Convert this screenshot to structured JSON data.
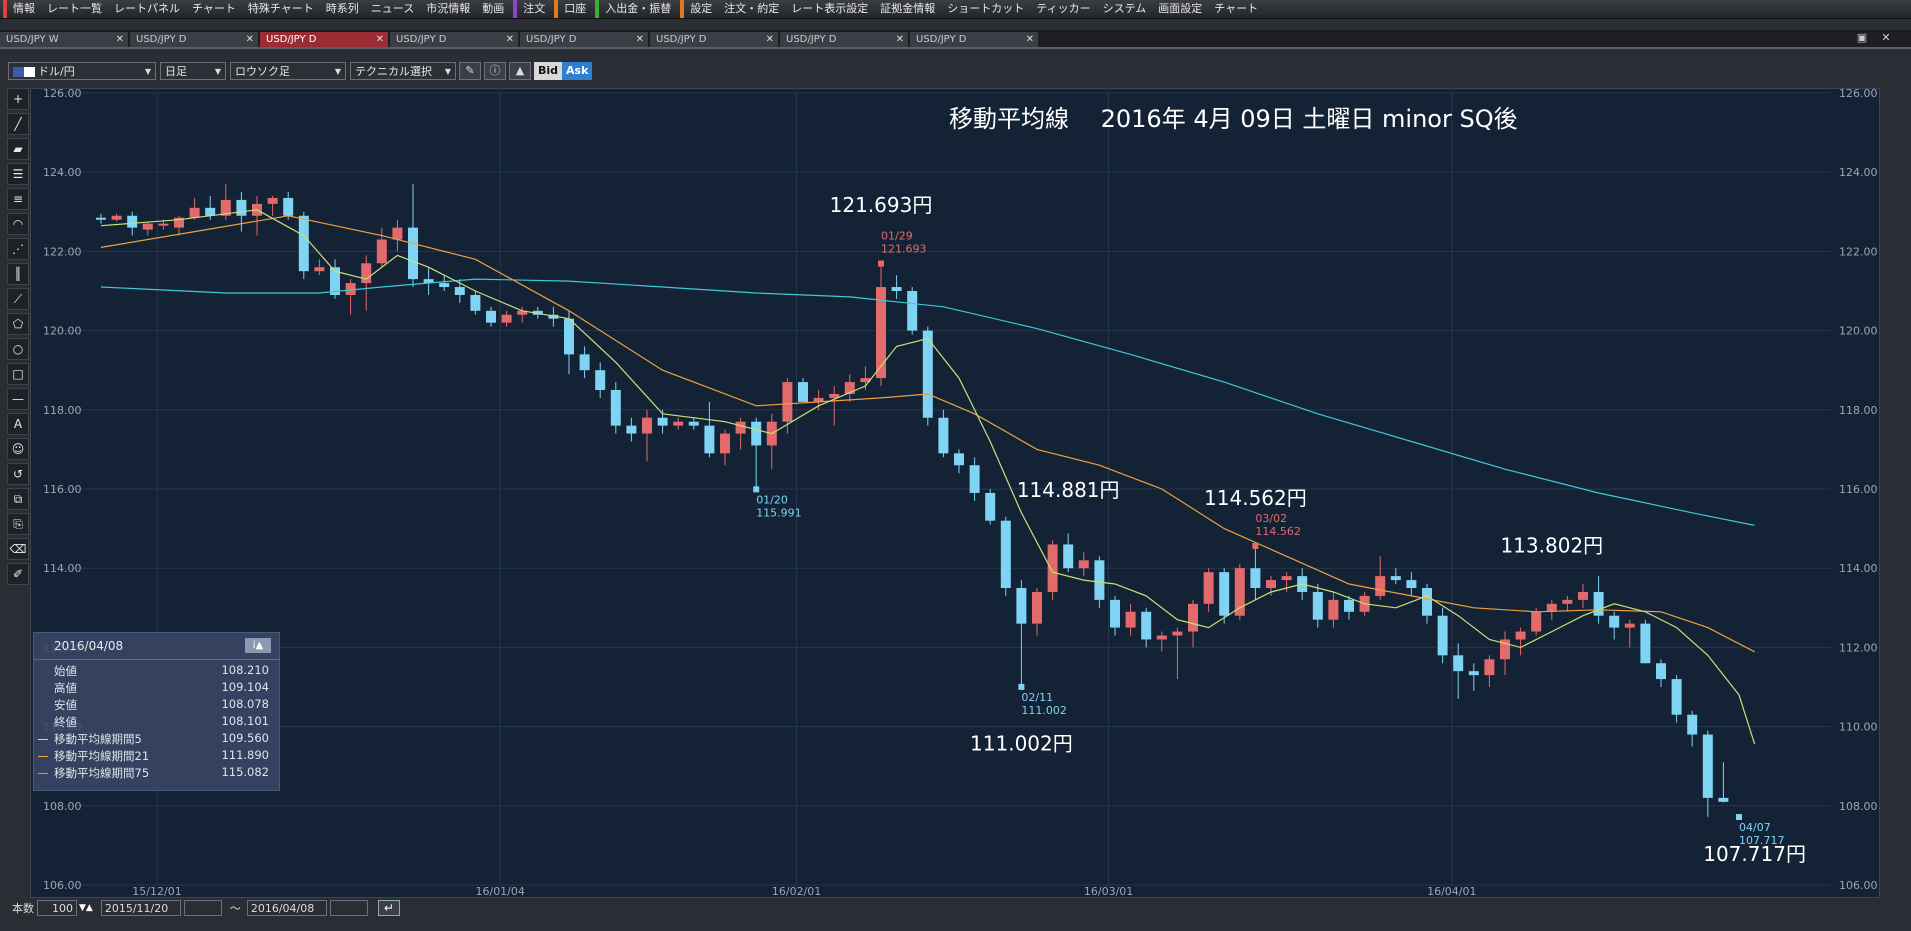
{
  "menu": [
    {
      "label": "情報",
      "accent": "#e04040"
    },
    {
      "label": "レート一覧"
    },
    {
      "label": "レートパネル"
    },
    {
      "label": "チャート"
    },
    {
      "label": "特殊チャート"
    },
    {
      "label": "時系列"
    },
    {
      "label": "ニュース"
    },
    {
      "label": "市況情報"
    },
    {
      "label": "動画"
    },
    {
      "label": "注文",
      "accent": "#8e44c8"
    },
    {
      "label": "口座",
      "accent": "#e07a20"
    },
    {
      "label": "入出金・振替",
      "accent": "#3cae3c"
    },
    {
      "label": "設定",
      "accent": "#e07a20"
    },
    {
      "label": "注文・約定"
    },
    {
      "label": "レート表示設定"
    },
    {
      "label": "証拠金情報"
    },
    {
      "label": "ショートカット"
    },
    {
      "label": "ティッカー"
    },
    {
      "label": "システム"
    },
    {
      "label": "画面設定"
    },
    {
      "label": "チャート"
    }
  ],
  "tabs": [
    {
      "label": "USD/JPY W",
      "active": false
    },
    {
      "label": "USD/JPY D",
      "active": false
    },
    {
      "label": "USD/JPY D",
      "active": true
    },
    {
      "label": "USD/JPY D",
      "active": false
    },
    {
      "label": "USD/JPY D",
      "active": false
    },
    {
      "label": "USD/JPY D",
      "active": false
    },
    {
      "label": "USD/JPY D",
      "active": false
    },
    {
      "label": "USD/JPY D",
      "active": false
    }
  ],
  "toolbar": {
    "pair": "ドル/円",
    "period": "日足",
    "style": "ロウソク足",
    "technical": "テクニカル選択",
    "bid": "Bid",
    "ask": "Ask"
  },
  "chart_data": {
    "type": "candlestick",
    "title": "移動平均線　 2016年 4月 09日 土曜日  minor SQ後",
    "ylim": [
      106,
      126
    ],
    "y_ticks": [
      "126.00",
      "124.00",
      "122.00",
      "120.00",
      "118.00",
      "116.00",
      "114.00",
      "112.00",
      "110.00",
      "108.00",
      "106.00"
    ],
    "x_ticks": [
      {
        "label": "15/12/01",
        "index": 0
      },
      {
        "label": "16/01/04",
        "index": 22
      },
      {
        "label": "16/02/01",
        "index": 41
      },
      {
        "label": "16/03/01",
        "index": 61
      },
      {
        "label": "16/04/01",
        "index": 83
      }
    ],
    "colors": {
      "up": "#e26a6a",
      "down": "#7fd3f3",
      "ma5": "#c9e07a",
      "ma21": "#f0a040",
      "ma75": "#3ec8d6"
    },
    "candles": [
      [
        122.85,
        122.95,
        122.7,
        122.8
      ],
      [
        122.8,
        122.95,
        122.75,
        122.9
      ],
      [
        122.9,
        123.0,
        122.4,
        122.6
      ],
      [
        122.55,
        122.75,
        122.4,
        122.7
      ],
      [
        122.65,
        122.8,
        122.55,
        122.7
      ],
      [
        122.6,
        122.9,
        122.4,
        122.85
      ],
      [
        122.85,
        123.35,
        122.8,
        123.1
      ],
      [
        123.1,
        123.4,
        122.8,
        122.9
      ],
      [
        122.9,
        123.7,
        122.8,
        123.3
      ],
      [
        123.3,
        123.5,
        122.5,
        122.9
      ],
      [
        122.9,
        123.4,
        122.4,
        123.2
      ],
      [
        123.2,
        123.4,
        122.9,
        123.35
      ],
      [
        123.35,
        123.5,
        122.8,
        122.9
      ],
      [
        122.9,
        123.0,
        121.3,
        121.5
      ],
      [
        121.5,
        121.8,
        121.4,
        121.6
      ],
      [
        121.6,
        121.8,
        120.8,
        120.9
      ],
      [
        120.9,
        121.3,
        120.4,
        121.2
      ],
      [
        121.2,
        121.9,
        120.5,
        121.7
      ],
      [
        121.7,
        122.6,
        121.6,
        122.3
      ],
      [
        122.3,
        122.8,
        122.0,
        122.6
      ],
      [
        122.6,
        123.7,
        121.1,
        121.3
      ],
      [
        121.3,
        121.6,
        120.9,
        121.2
      ],
      [
        121.2,
        121.4,
        121.0,
        121.1
      ],
      [
        121.1,
        121.3,
        120.7,
        120.9
      ],
      [
        120.9,
        121.0,
        120.4,
        120.5
      ],
      [
        120.5,
        120.6,
        120.1,
        120.2
      ],
      [
        120.2,
        120.5,
        120.1,
        120.4
      ],
      [
        120.4,
        120.6,
        120.2,
        120.5
      ],
      [
        120.5,
        120.6,
        120.3,
        120.4
      ],
      [
        120.4,
        120.6,
        120.1,
        120.3
      ],
      [
        120.3,
        120.5,
        118.9,
        119.4
      ],
      [
        119.4,
        119.6,
        118.8,
        119.0
      ],
      [
        119.0,
        119.2,
        118.3,
        118.5
      ],
      [
        118.5,
        118.7,
        117.4,
        117.6
      ],
      [
        117.6,
        117.8,
        117.2,
        117.4
      ],
      [
        117.4,
        118.0,
        116.7,
        117.8
      ],
      [
        117.8,
        118.0,
        117.4,
        117.6
      ],
      [
        117.6,
        117.8,
        117.5,
        117.7
      ],
      [
        117.7,
        117.8,
        117.5,
        117.6
      ],
      [
        117.6,
        118.2,
        116.8,
        116.9
      ],
      [
        116.9,
        117.5,
        116.6,
        117.4
      ],
      [
        117.4,
        117.8,
        117.0,
        117.7
      ],
      [
        117.7,
        117.8,
        115.99,
        117.1
      ],
      [
        117.1,
        117.9,
        116.5,
        117.7
      ],
      [
        117.7,
        118.8,
        117.4,
        118.7
      ],
      [
        118.7,
        118.8,
        118.2,
        118.2
      ],
      [
        118.2,
        118.5,
        118.0,
        118.3
      ],
      [
        118.3,
        118.6,
        117.6,
        118.4
      ],
      [
        118.4,
        118.9,
        118.2,
        118.7
      ],
      [
        118.7,
        119.1,
        118.5,
        118.8
      ],
      [
        118.8,
        121.69,
        118.6,
        121.1
      ],
      [
        121.1,
        121.4,
        120.8,
        121.0
      ],
      [
        121.0,
        121.1,
        119.9,
        120.0
      ],
      [
        120.0,
        120.1,
        117.6,
        117.8
      ],
      [
        117.8,
        118.0,
        116.8,
        116.9
      ],
      [
        116.9,
        117.0,
        116.4,
        116.6
      ],
      [
        116.6,
        116.8,
        115.7,
        115.9
      ],
      [
        115.9,
        116.0,
        115.1,
        115.2
      ],
      [
        115.2,
        115.3,
        113.3,
        113.5
      ],
      [
        113.5,
        113.7,
        111.0,
        112.6
      ],
      [
        112.6,
        113.5,
        112.3,
        113.4
      ],
      [
        113.4,
        114.7,
        113.2,
        114.6
      ],
      [
        114.6,
        114.88,
        113.9,
        114.0
      ],
      [
        114.0,
        114.4,
        113.8,
        114.2
      ],
      [
        114.2,
        114.3,
        113.0,
        113.2
      ],
      [
        113.2,
        113.3,
        112.3,
        112.5
      ],
      [
        112.5,
        113.1,
        112.3,
        112.9
      ],
      [
        112.9,
        113.0,
        112.0,
        112.2
      ],
      [
        112.2,
        112.4,
        111.9,
        112.3
      ],
      [
        112.3,
        112.5,
        111.2,
        112.4
      ],
      [
        112.4,
        113.2,
        112.0,
        113.1
      ],
      [
        113.1,
        114.0,
        112.9,
        113.9
      ],
      [
        113.9,
        114.0,
        112.6,
        112.8
      ],
      [
        112.8,
        114.1,
        112.7,
        114.0
      ],
      [
        114.0,
        114.56,
        113.2,
        113.5
      ],
      [
        113.5,
        113.8,
        113.3,
        113.7
      ],
      [
        113.7,
        113.9,
        113.4,
        113.8
      ],
      [
        113.8,
        114.0,
        113.2,
        113.4
      ],
      [
        113.4,
        113.6,
        112.5,
        112.7
      ],
      [
        112.7,
        113.4,
        112.5,
        113.2
      ],
      [
        113.2,
        113.3,
        112.7,
        112.9
      ],
      [
        112.9,
        113.4,
        112.8,
        113.3
      ],
      [
        113.3,
        114.3,
        113.2,
        113.8
      ],
      [
        113.8,
        114.0,
        113.6,
        113.7
      ],
      [
        113.7,
        113.9,
        113.3,
        113.5
      ],
      [
        113.5,
        113.6,
        112.6,
        112.8
      ],
      [
        112.8,
        113.0,
        111.6,
        111.8
      ],
      [
        111.8,
        112.1,
        110.7,
        111.4
      ],
      [
        111.4,
        111.6,
        110.9,
        111.3
      ],
      [
        111.3,
        111.8,
        111.0,
        111.7
      ],
      [
        111.7,
        112.4,
        111.3,
        112.2
      ],
      [
        112.2,
        112.5,
        111.8,
        112.4
      ],
      [
        112.4,
        113.0,
        112.3,
        112.9
      ],
      [
        112.9,
        113.2,
        112.7,
        113.1
      ],
      [
        113.1,
        113.3,
        112.9,
        113.2
      ],
      [
        113.2,
        113.6,
        113.0,
        113.4
      ],
      [
        113.4,
        113.8,
        112.6,
        112.8
      ],
      [
        112.8,
        112.9,
        112.2,
        112.5
      ],
      [
        112.5,
        112.7,
        112.0,
        112.6
      ],
      [
        112.6,
        112.7,
        111.6,
        111.6
      ],
      [
        111.6,
        111.7,
        111.0,
        111.2
      ],
      [
        111.2,
        111.3,
        110.1,
        110.3
      ],
      [
        110.3,
        110.4,
        109.5,
        109.8
      ],
      [
        109.8,
        109.9,
        107.72,
        108.2
      ],
      [
        108.2,
        109.1,
        108.08,
        108.1
      ]
    ],
    "ma5": [
      [
        0,
        122.65
      ],
      [
        5,
        122.8
      ],
      [
        10,
        123.05
      ],
      [
        13,
        122.4
      ],
      [
        15,
        121.5
      ],
      [
        17,
        121.3
      ],
      [
        19,
        121.9
      ],
      [
        21,
        121.6
      ],
      [
        24,
        121.0
      ],
      [
        27,
        120.5
      ],
      [
        30,
        120.3
      ],
      [
        33,
        119.2
      ],
      [
        36,
        117.9
      ],
      [
        40,
        117.7
      ],
      [
        43,
        117.4
      ],
      [
        46,
        118.1
      ],
      [
        49,
        118.6
      ],
      [
        51,
        119.6
      ],
      [
        53,
        119.8
      ],
      [
        55,
        118.8
      ],
      [
        57,
        117.2
      ],
      [
        59,
        115.4
      ],
      [
        61,
        113.9
      ],
      [
        63,
        113.7
      ],
      [
        65,
        113.6
      ],
      [
        67,
        113.3
      ],
      [
        69,
        112.7
      ],
      [
        71,
        112.5
      ],
      [
        73,
        113.0
      ],
      [
        75,
        113.4
      ],
      [
        77,
        113.6
      ],
      [
        79,
        113.4
      ],
      [
        81,
        113.1
      ],
      [
        83,
        113.0
      ],
      [
        85,
        113.3
      ],
      [
        87,
        112.8
      ],
      [
        89,
        112.2
      ],
      [
        91,
        112.0
      ],
      [
        93,
        112.4
      ],
      [
        95,
        112.8
      ],
      [
        97,
        113.1
      ],
      [
        99,
        112.9
      ],
      [
        101,
        112.5
      ],
      [
        103,
        111.8
      ],
      [
        105,
        110.8
      ],
      [
        106,
        109.56
      ]
    ],
    "ma21": [
      [
        0,
        122.1
      ],
      [
        6,
        122.5
      ],
      [
        12,
        122.9
      ],
      [
        18,
        122.4
      ],
      [
        24,
        121.8
      ],
      [
        30,
        120.5
      ],
      [
        36,
        119.0
      ],
      [
        42,
        118.1
      ],
      [
        46,
        118.2
      ],
      [
        50,
        118.3
      ],
      [
        53,
        118.4
      ],
      [
        56,
        117.9
      ],
      [
        60,
        117.0
      ],
      [
        64,
        116.6
      ],
      [
        68,
        116.0
      ],
      [
        72,
        115.0
      ],
      [
        76,
        114.3
      ],
      [
        80,
        113.6
      ],
      [
        84,
        113.3
      ],
      [
        88,
        113.0
      ],
      [
        92,
        112.9
      ],
      [
        96,
        112.95
      ],
      [
        100,
        112.9
      ],
      [
        103,
        112.5
      ],
      [
        106,
        111.89
      ]
    ],
    "ma75": [
      [
        0,
        121.1
      ],
      [
        8,
        120.95
      ],
      [
        14,
        120.95
      ],
      [
        18,
        121.1
      ],
      [
        24,
        121.3
      ],
      [
        30,
        121.25
      ],
      [
        36,
        121.1
      ],
      [
        42,
        120.95
      ],
      [
        48,
        120.85
      ],
      [
        54,
        120.6
      ],
      [
        60,
        120.05
      ],
      [
        66,
        119.4
      ],
      [
        72,
        118.7
      ],
      [
        78,
        117.9
      ],
      [
        84,
        117.2
      ],
      [
        90,
        116.5
      ],
      [
        96,
        115.9
      ],
      [
        102,
        115.4
      ],
      [
        106,
        115.08
      ]
    ],
    "markers": [
      {
        "index": 50,
        "type": "high",
        "date": "01/29",
        "value": "121.693"
      },
      {
        "index": 42,
        "type": "low",
        "date": "01/20",
        "value": "115.991"
      },
      {
        "index": 59,
        "type": "low",
        "date": "02/11",
        "value": "111.002"
      },
      {
        "index": 74,
        "type": "high",
        "date": "03/02",
        "value": "114.562"
      },
      {
        "index": 105,
        "type": "low",
        "date": "04/07",
        "value": "107.717"
      }
    ],
    "annotations": [
      {
        "text": "121.693円",
        "index": 50,
        "price": 123.0
      },
      {
        "text": "114.881円",
        "index": 62,
        "price": 115.8
      },
      {
        "text": "114.562円",
        "index": 74,
        "price": 115.6
      },
      {
        "text": "113.802円",
        "index": 93,
        "price": 114.4
      },
      {
        "text": "111.002円",
        "index": 59,
        "price": 109.4
      },
      {
        "text": "107.717円",
        "index": 106,
        "price": 106.6
      }
    ]
  },
  "info_panel": {
    "date": "2016/04/08",
    "button": "i▲",
    "rows": [
      {
        "label": "始値",
        "value": "108.210"
      },
      {
        "label": "高値",
        "value": "109.104"
      },
      {
        "label": "安値",
        "value": "108.078"
      },
      {
        "label": "終値",
        "value": "108.101"
      },
      {
        "label": "移動平均線期間5",
        "value": "109.560",
        "color": "#c9e07a"
      },
      {
        "label": "移動平均線期間21",
        "value": "111.890",
        "color": "#f0a040"
      },
      {
        "label": "移動平均線期間75",
        "value": "115.082",
        "color": "#3ec8d6"
      }
    ]
  },
  "bottom": {
    "count_label": "本数",
    "count_value": "100",
    "from": "2015/11/20",
    "tilde": "〜",
    "to": "2016/04/08"
  }
}
